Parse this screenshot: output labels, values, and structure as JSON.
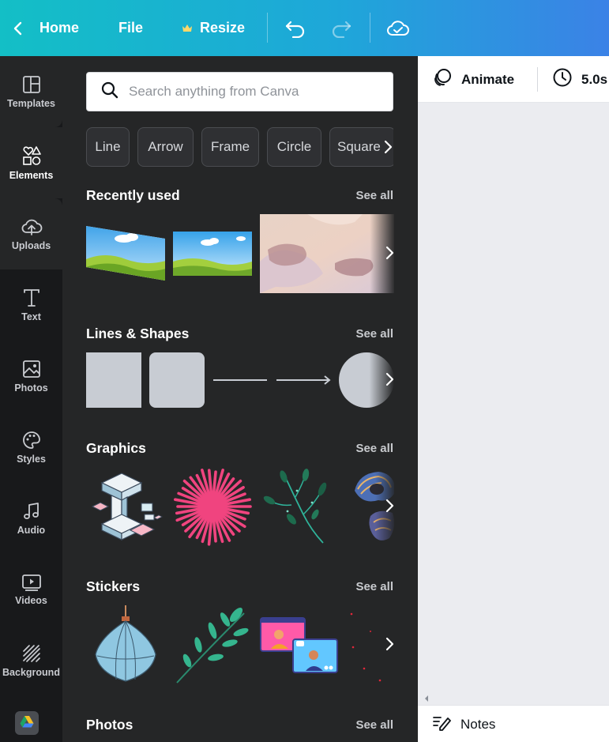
{
  "topbar": {
    "home_label": "Home",
    "file_label": "File",
    "resize_label": "Resize",
    "gradient_start": "#13bfc6",
    "gradient_end": "#3b82e6"
  },
  "rail": {
    "items": [
      {
        "label": "Templates",
        "icon": "templates-icon"
      },
      {
        "label": "Elements",
        "icon": "elements-icon"
      },
      {
        "label": "Uploads",
        "icon": "cloud-upload-icon"
      },
      {
        "label": "Text",
        "icon": "text-icon"
      },
      {
        "label": "Photos",
        "icon": "image-icon"
      },
      {
        "label": "Styles",
        "icon": "palette-icon"
      },
      {
        "label": "Audio",
        "icon": "music-note-icon"
      },
      {
        "label": "Videos",
        "icon": "video-icon"
      },
      {
        "label": "Background",
        "icon": "hatch-icon"
      }
    ],
    "active_index": 1
  },
  "panel": {
    "search_placeholder": "Search anything from Canva",
    "chips": [
      "Line",
      "Arrow",
      "Frame",
      "Circle",
      "Square"
    ],
    "see_all": "See all",
    "sections": {
      "recent": "Recently used",
      "shapes": "Lines & Shapes",
      "graphics": "Graphics",
      "stickers": "Stickers",
      "photos": "Photos"
    }
  },
  "canvas": {
    "animate_label": "Animate",
    "duration_label": "5.0s",
    "notes_label": "Notes"
  },
  "colors": {
    "panel_bg": "#252627",
    "rail_bg": "#18191b",
    "canvas_bg": "#ebecf0"
  }
}
